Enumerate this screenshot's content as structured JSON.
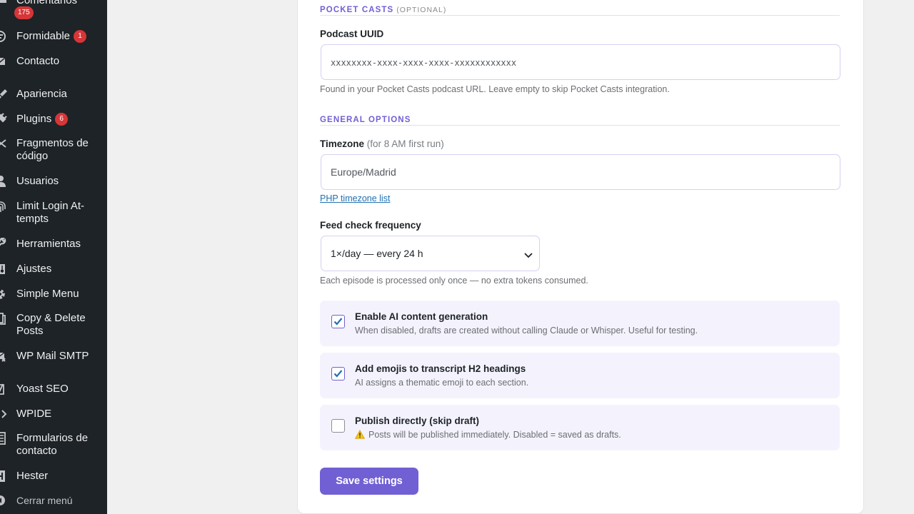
{
  "sidebar": {
    "items": [
      {
        "label": "Comentarios",
        "badge": "175",
        "icon": "comments-icon"
      },
      {
        "label": "Formidable",
        "badge": "1",
        "icon": "formidable-icon"
      },
      {
        "label": "Contacto",
        "badge": null,
        "icon": "mail-icon"
      },
      {
        "label": "Apariencia",
        "badge": null,
        "icon": "brush-icon"
      },
      {
        "label": "Plugins",
        "badge": "6",
        "icon": "plug-icon"
      },
      {
        "label": "Fragmentos de código",
        "badge": null,
        "icon": "scissors-icon"
      },
      {
        "label": "Usuarios",
        "badge": null,
        "icon": "user-icon"
      },
      {
        "label": "Limit Login At-tempts",
        "badge": null,
        "icon": "fingerprint-icon"
      },
      {
        "label": "Herramientas",
        "badge": null,
        "icon": "wrench-icon"
      },
      {
        "label": "Ajustes",
        "badge": null,
        "icon": "sliders-icon"
      },
      {
        "label": "Simple Menu",
        "badge": null,
        "icon": "gear-icon"
      },
      {
        "label": "Copy & Delete Posts",
        "badge": null,
        "icon": "copy-icon"
      },
      {
        "label": "WP Mail SMTP",
        "badge": null,
        "icon": "mail-smtp-icon"
      },
      {
        "label": "Yoast SEO",
        "badge": null,
        "icon": "yoast-icon"
      },
      {
        "label": "WPIDE",
        "badge": null,
        "icon": "code-icon"
      },
      {
        "label": "Formularios de contacto",
        "badge": null,
        "icon": "form-list-icon"
      },
      {
        "label": "Hester",
        "badge": null,
        "icon": "hester-icon"
      }
    ],
    "collapse_label": "Cerrar menú"
  },
  "pocket_casts": {
    "section_title": "POCKET CASTS",
    "section_optional": "(OPTIONAL)",
    "uuid_label": "Podcast UUID",
    "uuid_placeholder": "xxxxxxxx-xxxx-xxxx-xxxx-xxxxxxxxxxxx",
    "uuid_help": "Found in your Pocket Casts podcast URL. Leave empty to skip Pocket Casts integration."
  },
  "general": {
    "section_title": "GENERAL OPTIONS",
    "timezone_label": "Timezone",
    "timezone_hint": "(for 8 AM first run)",
    "timezone_value": "Europe/Madrid",
    "timezone_link": "PHP timezone list",
    "frequency_label": "Feed check frequency",
    "frequency_value": "1×/day — every 24 h",
    "frequency_help": "Each episode is processed only once — no extra tokens consumed."
  },
  "toggles": [
    {
      "title": "Enable AI content generation",
      "desc": "When disabled, drafts are created without calling Claude or Whisper. Useful for testing.",
      "checked": true
    },
    {
      "title": "Add emojis to transcript H2 headings",
      "desc": "AI assigns a thematic emoji to each section.",
      "checked": true
    },
    {
      "title": "Publish directly (skip draft)",
      "desc": "Posts will be published immediately. Disabled = saved as drafts.",
      "checked": false,
      "warning": true
    }
  ],
  "save_label": "Save settings",
  "colors": {
    "accent": "#7160d4",
    "sidebar_bg": "#1d2327",
    "badge": "#d63638",
    "link": "#2271b1",
    "toggle_bg": "#f4f3fd"
  }
}
